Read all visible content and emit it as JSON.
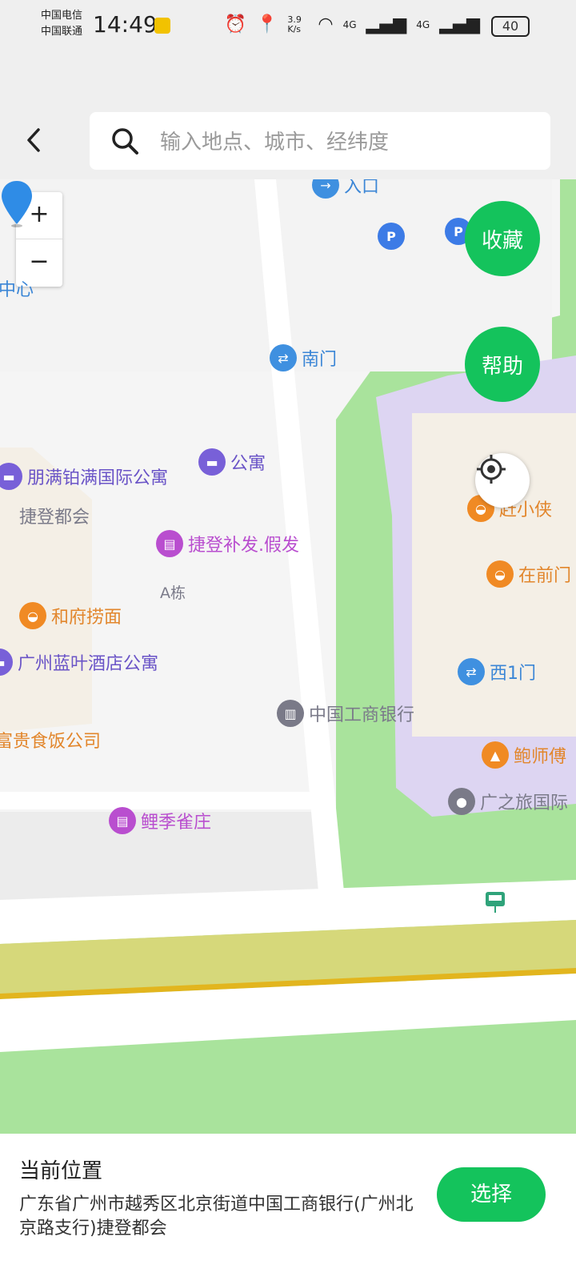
{
  "status_bar": {
    "carrier_1": "中国电信",
    "carrier_2": "中国联通",
    "time": "14:49",
    "net_speed": "3.9 K/s",
    "signal_1": "4G",
    "signal_2": "4G",
    "battery": "40"
  },
  "search": {
    "placeholder": "输入地点、城市、经纬度",
    "value": ""
  },
  "map": {
    "zoom_in": "+",
    "zoom_out": "−",
    "favorite_label": "收藏",
    "help_label": "帮助",
    "parking_label": "P",
    "pois": {
      "entrance": "入口",
      "center_partial": "中心",
      "south_gate": "南门",
      "apartment": "公寓",
      "pengman": "朋满铂满国际公寓",
      "jiedeng_duhui": "捷登都会",
      "jiedeng_hair": "捷登补发.假发",
      "building_a": "A栋",
      "hefu": "和府捞面",
      "lanye": "广州蓝叶酒店公寓",
      "icbc": "中国工商银行",
      "fugui": "富贵食饭公司",
      "liji": "鲤季雀庄",
      "xiaoxia": "赶小侠",
      "zaiqianmen": "在前门",
      "west_gate": "西1门",
      "baoshi": "鲍师傅",
      "guangzhilv": "广之旅国际"
    }
  },
  "bottom": {
    "title": "当前位置",
    "address": "广东省广州市越秀区北京街道中国工商银行(广州北京路支行)捷登都会",
    "choose_label": "选择"
  },
  "colors": {
    "accent_green": "#14c35c",
    "map_green": "#a9e39c",
    "map_purple": "#ddd5f2",
    "road_yellow": "#d6d87a"
  }
}
